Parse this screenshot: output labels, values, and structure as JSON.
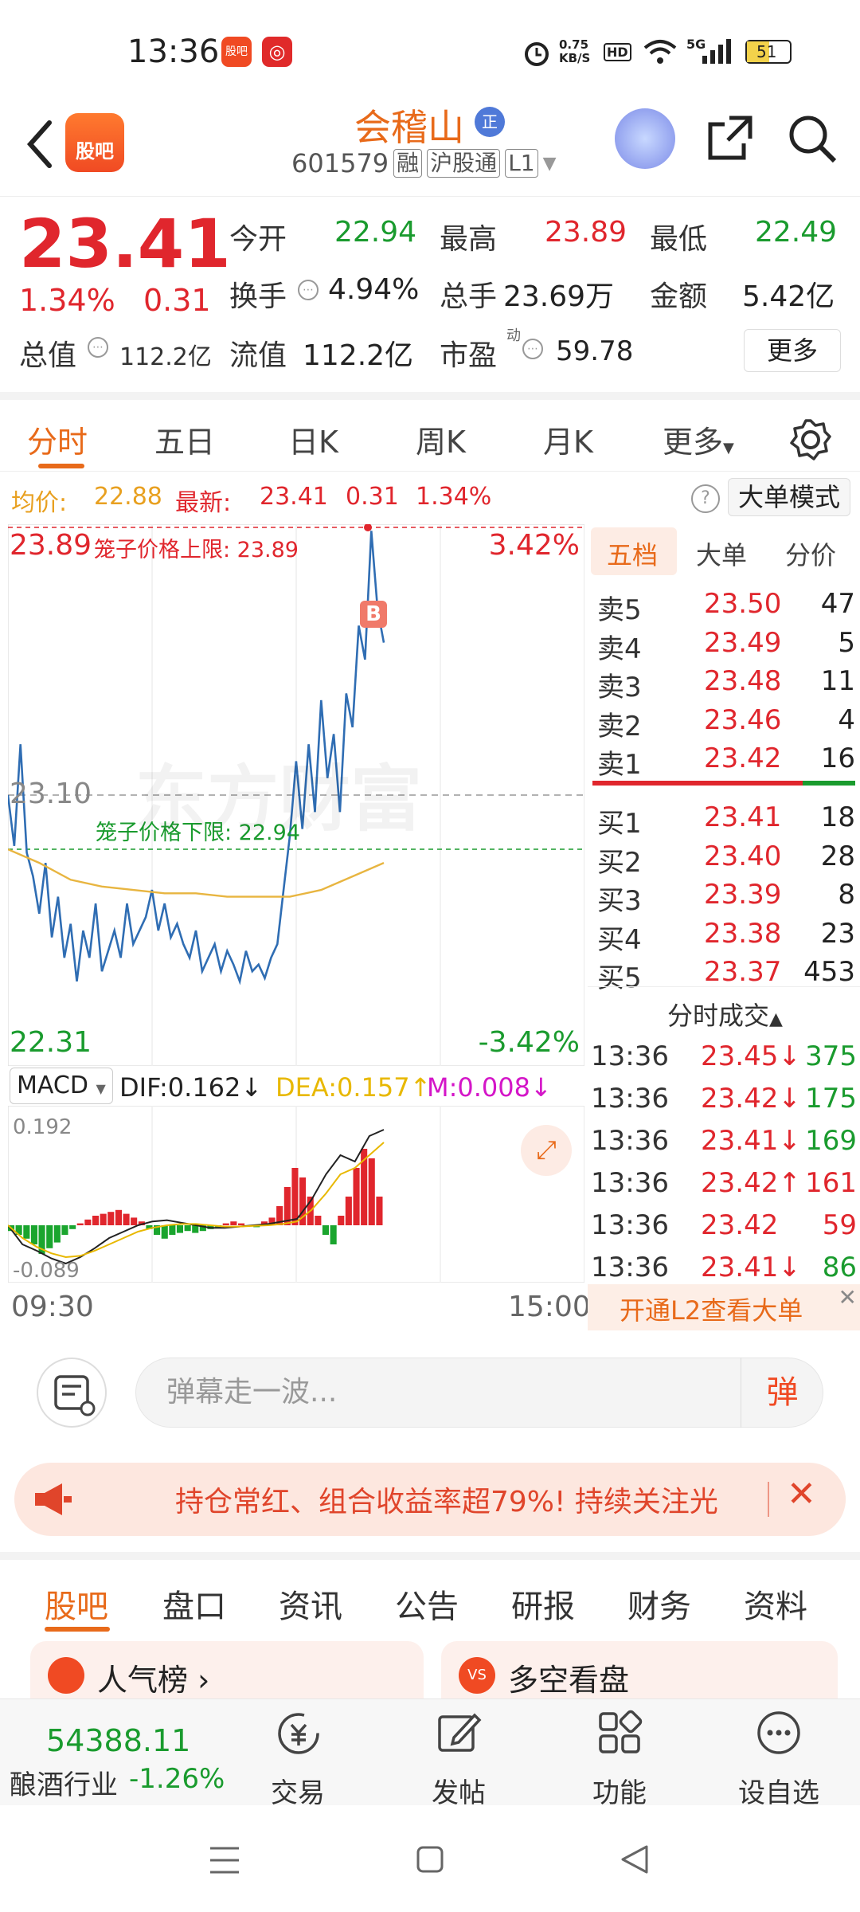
{
  "status": {
    "time": "13:36",
    "badge1": "股吧",
    "badge2": "◎",
    "net_speed": "0.75 KB/S",
    "hd": "HD",
    "signal": "5G",
    "battery": "51"
  },
  "header": {
    "logo": "股吧",
    "name": "会稽山",
    "zheng": "正",
    "code": "601579",
    "tag_rong": "融",
    "tag_hgt": "沪股通",
    "tag_l1": "L1"
  },
  "quote": {
    "price": "23.41",
    "change_pct": "1.34%",
    "change": "0.31",
    "open_label": "今开",
    "open": "22.94",
    "high_label": "最高",
    "high": "23.89",
    "low_label": "最低",
    "low": "22.49",
    "turnover_label": "换手",
    "turnover": "4.94%",
    "volume_label": "总手",
    "volume": "23.69万",
    "amount_label": "金额",
    "amount": "5.42亿",
    "mcap_label": "总值",
    "mcap": "112.2亿",
    "float_label": "流值",
    "float": "112.2亿",
    "pe_label": "市盈",
    "pe_sup": "动",
    "pe": "59.78",
    "more": "更多"
  },
  "tabs": [
    "分时",
    "五日",
    "日K",
    "周K",
    "月K",
    "更多"
  ],
  "infoline": {
    "avg_label": "均价:",
    "avg": "22.88",
    "latest_label": "最新:",
    "latest": "23.41",
    "chg": "0.31",
    "pct": "1.34%",
    "mode": "大单模式"
  },
  "chart": {
    "top_price": "23.89",
    "top_limit_label": "笼子价格上限: 23.89",
    "top_pct": "3.42%",
    "mid_price": "23.10",
    "low_limit_label": "笼子价格下限: 22.94",
    "bottom_price": "22.31",
    "bottom_pct": "-3.42%",
    "marker": "B",
    "watermark": "东方财富",
    "time_start": "09:30",
    "time_end": "15:00"
  },
  "chart_data": {
    "type": "line",
    "title": "",
    "ylim": [
      22.31,
      23.89
    ],
    "x": [
      "09:30",
      "09:45",
      "10:00",
      "10:15",
      "10:30",
      "10:45",
      "11:00",
      "11:15",
      "11:30",
      "13:00",
      "13:15",
      "13:30",
      "13:36"
    ],
    "series": [
      {
        "values": [
          23.1,
          22.85,
          22.6,
          22.64,
          22.73,
          22.6,
          22.63,
          22.58,
          22.6,
          22.9,
          23.05,
          23.3,
          23.41
        ]
      },
      {
        "values": [
          22.94,
          22.87,
          22.84,
          22.83,
          22.82,
          22.81,
          22.8,
          22.8,
          22.8,
          22.8,
          22.82,
          22.86,
          22.88
        ]
      }
    ]
  },
  "macd": {
    "label": "MACD",
    "dif": "DIF:0.162",
    "dea": "DEA:0.157",
    "m": "M:0.008",
    "top": "0.192",
    "bottom": "-0.089"
  },
  "book": {
    "tabs": [
      "五档",
      "大单",
      "分价"
    ],
    "sells": [
      {
        "l": "卖5",
        "p": "23.50",
        "v": "47"
      },
      {
        "l": "卖4",
        "p": "23.49",
        "v": "5"
      },
      {
        "l": "卖3",
        "p": "23.48",
        "v": "11"
      },
      {
        "l": "卖2",
        "p": "23.46",
        "v": "4"
      },
      {
        "l": "卖1",
        "p": "23.42",
        "v": "16"
      }
    ],
    "buys": [
      {
        "l": "买1",
        "p": "23.41",
        "v": "18"
      },
      {
        "l": "买2",
        "p": "23.40",
        "v": "28"
      },
      {
        "l": "买3",
        "p": "23.39",
        "v": "8"
      },
      {
        "l": "买4",
        "p": "23.38",
        "v": "23"
      },
      {
        "l": "买5",
        "p": "23.37",
        "v": "453"
      }
    ],
    "trades_title": "分时成交",
    "trades": [
      {
        "t": "13:36",
        "p": "23.45↓",
        "v": "375",
        "c": "green"
      },
      {
        "t": "13:36",
        "p": "23.42↓",
        "v": "175",
        "c": "green"
      },
      {
        "t": "13:36",
        "p": "23.41↓",
        "v": "169",
        "c": "green"
      },
      {
        "t": "13:36",
        "p": "23.42↑",
        "v": "161",
        "c": "red"
      },
      {
        "t": "13:36",
        "p": "23.42",
        "v": "59",
        "c": "red"
      },
      {
        "t": "13:36",
        "p": "23.41↓",
        "v": "86",
        "c": "green"
      }
    ],
    "l2": "开通L2查看大单"
  },
  "comment": {
    "placeholder": "弹幕走一波...",
    "danmu": "弹"
  },
  "banner": {
    "text": "持仓常红、组合收益率超79%! 持续关注光"
  },
  "btabs": [
    "股吧",
    "盘口",
    "资讯",
    "公告",
    "研报",
    "财务",
    "资料"
  ],
  "cards": [
    "人气榜",
    "多空看盘"
  ],
  "nav": {
    "index_value": "54388.11",
    "index_name": "酿酒行业",
    "index_pct": "-1.26%",
    "trade": "交易",
    "post": "发帖",
    "func": "功能",
    "watch": "设自选"
  }
}
